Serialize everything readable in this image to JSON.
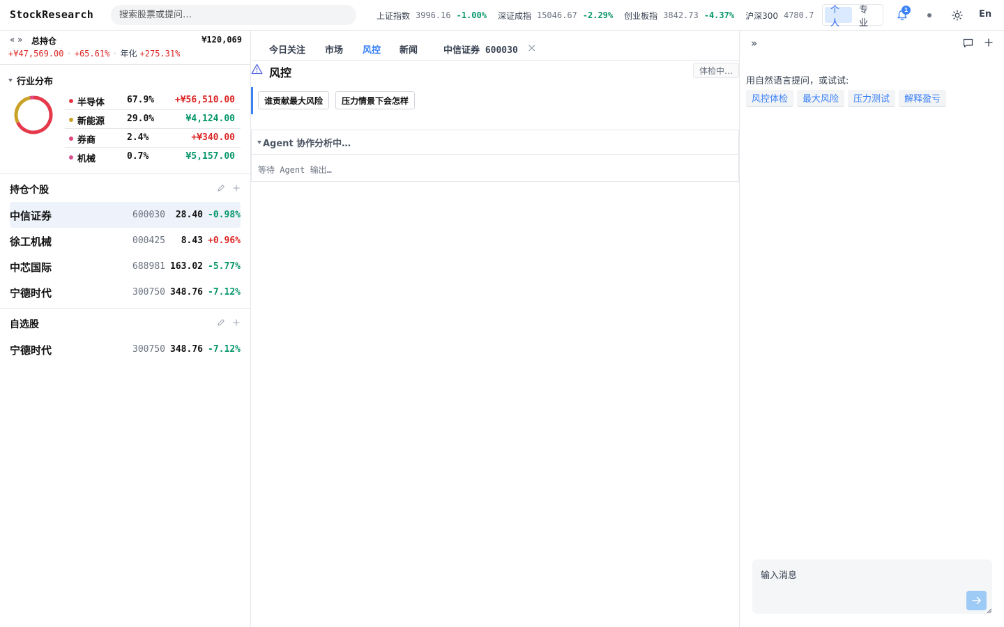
{
  "header": {
    "brand": "StockResearch",
    "search_placeholder": "搜索股票或提问…",
    "indices": [
      {
        "name": "上证指数",
        "value": "3996.16",
        "change": "-1.00%"
      },
      {
        "name": "深证成指",
        "value": "15046.67",
        "change": "-2.29%"
      },
      {
        "name": "创业板指",
        "value": "3842.73",
        "change": "-4.37%"
      },
      {
        "name": "沪深300",
        "value": "4780.7",
        "change": ""
      }
    ],
    "mode_personal": "个人",
    "mode_pro": "专业",
    "notification_count": "1",
    "lang": "En",
    "colors": {
      "up": "#dc2626",
      "down": "#059669",
      "accent": "#3b82f6"
    }
  },
  "portfolio": {
    "title": "总持仓",
    "total": "¥120,069",
    "pnl": "+¥47,569.00",
    "pnl_pct": "+65.61%",
    "annualized_label": "年化",
    "annualized": "+275.31%"
  },
  "industry": {
    "title": "行业分布",
    "items": [
      {
        "name": "半导体",
        "pct": "67.9%",
        "share": 0.679,
        "pnl": "+¥56,510.00",
        "color": "#e5394b"
      },
      {
        "name": "新能源",
        "pct": "29.0%",
        "share": 0.29,
        "pnl": "¥4,124.00",
        "color": "#c9a227"
      },
      {
        "name": "券商",
        "pct": "2.4%",
        "share": 0.024,
        "pnl": "+¥340.00",
        "color": "#e0457b"
      },
      {
        "name": "机械",
        "pct": "0.7%",
        "share": 0.007,
        "pnl": "¥5,157.00",
        "color": "#d94e8f"
      }
    ]
  },
  "holdings": {
    "title": "持仓个股",
    "rows": [
      {
        "name": "中信证券",
        "code": "600030",
        "price": "28.40",
        "change": "-0.98%"
      },
      {
        "name": "徐工机械",
        "code": "000425",
        "price": "8.43",
        "change": "+0.96%"
      },
      {
        "name": "中芯国际",
        "code": "688981",
        "price": "163.02",
        "change": "-5.77%"
      },
      {
        "name": "宁德时代",
        "code": "300750",
        "price": "348.76",
        "change": "-7.12%"
      }
    ]
  },
  "watchlist": {
    "title": "自选股",
    "rows": [
      {
        "name": "宁德时代",
        "code": "300750",
        "price": "348.76",
        "change": "-7.12%"
      }
    ]
  },
  "tabs": {
    "today": "今日关注",
    "market": "市场",
    "risk": "风控",
    "news": "新闻",
    "stock": "中信证券 600030"
  },
  "risk": {
    "title": "风控",
    "status": "体检中…",
    "q1": "谁贡献最大风险",
    "q2": "压力情景下会怎样",
    "agent_title": "Agent 协作分析中…",
    "agent_wait": "等待 Agent 输出…"
  },
  "assistant": {
    "hint": "用自然语言提问，或试试:",
    "suggestions": [
      "风控体检",
      "最大风险",
      "压力测试",
      "解释盈亏"
    ],
    "input_placeholder": "输入消息"
  }
}
